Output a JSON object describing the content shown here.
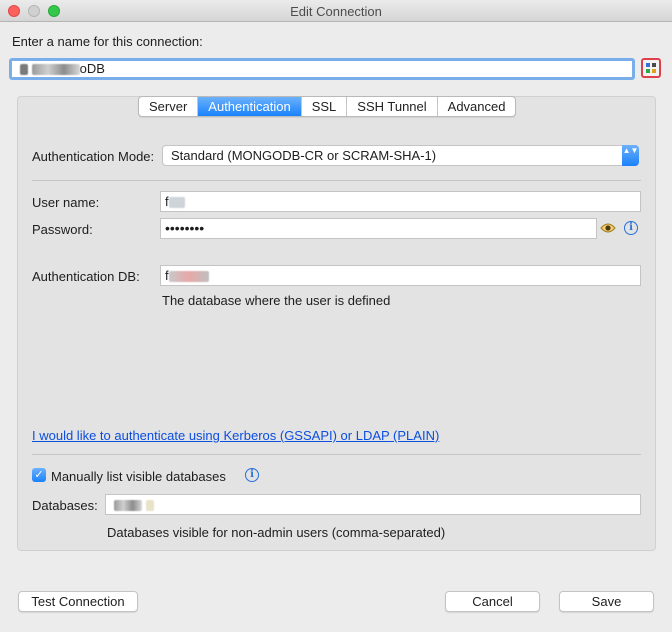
{
  "window": {
    "title": "Edit Connection"
  },
  "connection": {
    "label": "Enter a name for this connection:",
    "name_suffix": "oDB"
  },
  "tabs": [
    {
      "label": "Server",
      "active": false
    },
    {
      "label": "Authentication",
      "active": true
    },
    {
      "label": "SSL",
      "active": false
    },
    {
      "label": "SSH Tunnel",
      "active": false
    },
    {
      "label": "Advanced",
      "active": false
    }
  ],
  "auth": {
    "mode_label": "Authentication Mode:",
    "mode_value": "Standard (MONGODB-CR or SCRAM-SHA-1)",
    "username_label": "User name:",
    "username_visible": "f",
    "password_label": "Password:",
    "password_value": "••••••••",
    "authdb_label": "Authentication DB:",
    "authdb_visible": "f",
    "authdb_hint": "The database where the user is defined",
    "kerberos_link": "I would like to authenticate using Kerberos (GSSAPI) or LDAP (PLAIN)"
  },
  "databases": {
    "checkbox_label": "Manually list visible databases",
    "checked": true,
    "label": "Databases:",
    "hint": "Databases visible for non-admin users (comma-separated)"
  },
  "buttons": {
    "test": "Test Connection",
    "cancel": "Cancel",
    "save": "Save"
  },
  "icons": {
    "eye": "eye-icon",
    "info": "info-icon",
    "palette": "color-palette-icon",
    "info_glyph": "i",
    "check_glyph": "✓",
    "arrows_glyph": "▲▼"
  },
  "colors": {
    "accent": "#1a82fb",
    "link": "#0b4ee0",
    "highlight": "#e0404e"
  }
}
